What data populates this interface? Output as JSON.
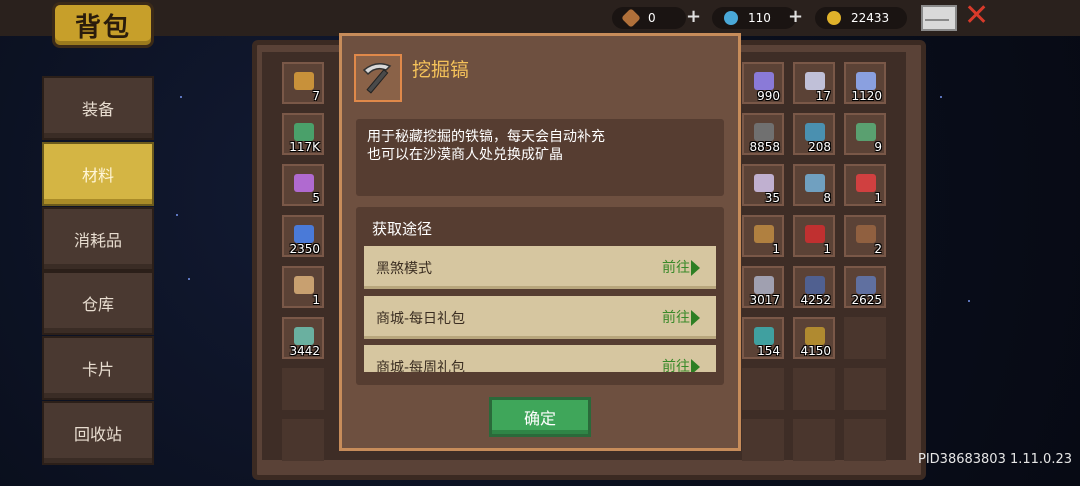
{
  "header": {
    "title": "背包",
    "resources": [
      {
        "icon": "leaf-icon",
        "value": "0",
        "color": "#b0703a"
      },
      {
        "icon": "blue-gem-icon",
        "value": "110",
        "color": "#4aa8d8"
      },
      {
        "icon": "gold-coin-icon",
        "value": "22433",
        "color": "#e0b22a"
      }
    ]
  },
  "sidebar": {
    "items": [
      {
        "label": "装备"
      },
      {
        "label": "材料",
        "active": true
      },
      {
        "label": "消耗品"
      },
      {
        "label": "仓库"
      },
      {
        "label": "卡片"
      },
      {
        "label": "回收站"
      }
    ]
  },
  "inventory": {
    "left_cells": [
      {
        "count": "7",
        "color": "#c8913a"
      },
      {
        "count": "117K",
        "color": "#4aa06a"
      },
      {
        "count": "5",
        "color": "#b06ad0"
      },
      {
        "count": "2350",
        "color": "#4a7ad8"
      },
      {
        "count": "1",
        "color": "#c8a070"
      },
      {
        "count": "3442",
        "color": "#6ab0a0"
      }
    ],
    "right_cells": [
      {
        "count": "990",
        "color": "#8a7ad8"
      },
      {
        "count": "17",
        "color": "#c0c0d8"
      },
      {
        "count": "1120",
        "color": "#8aa0e0"
      },
      {
        "count": "8858",
        "color": "#707070"
      },
      {
        "count": "208",
        "color": "#4a90b0"
      },
      {
        "count": "9",
        "color": "#5aa070"
      },
      {
        "count": "35",
        "color": "#c0b0d0"
      },
      {
        "count": "8",
        "color": "#70a0c0"
      },
      {
        "count": "1",
        "color": "#d04040"
      },
      {
        "count": "1",
        "color": "#b08040"
      },
      {
        "count": "1",
        "color": "#c03030"
      },
      {
        "count": "2",
        "color": "#906040"
      },
      {
        "count": "3017",
        "color": "#a0a0b0"
      },
      {
        "count": "4252",
        "color": "#506090"
      },
      {
        "count": "2625",
        "color": "#6070a0"
      },
      {
        "count": "154",
        "color": "#40a0a0"
      },
      {
        "count": "4150",
        "color": "#b08a30"
      }
    ]
  },
  "modal": {
    "item_name": "挖掘镐",
    "description_line1": "用于秘藏挖掘的铁镐，每天会自动补充",
    "description_line2": "也可以在沙漠商人处兑换成矿晶",
    "ways_title": "获取途径",
    "ways": [
      {
        "label": "黑煞模式",
        "go": "前往"
      },
      {
        "label": "商城-每日礼包",
        "go": "前往"
      },
      {
        "label": "商城-每周礼包",
        "go": "前往"
      }
    ],
    "confirm_label": "确定"
  },
  "footer": {
    "pid": "PID38683803 1.11.0.23"
  }
}
